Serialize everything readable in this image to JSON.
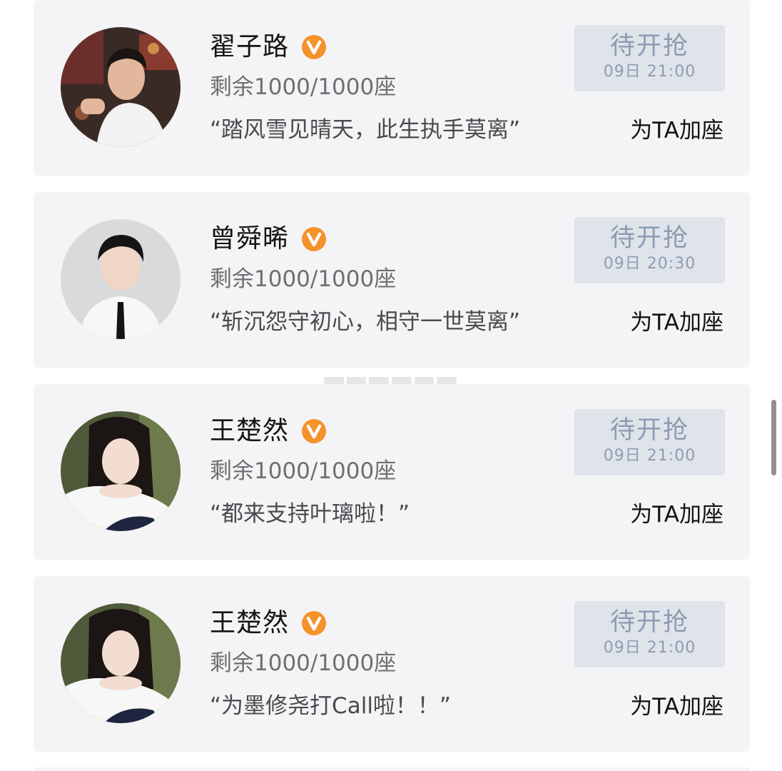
{
  "cards": [
    {
      "name": "翟子路",
      "remaining": "剩余1000/1000座",
      "slogan": "“踏风雪见晴天，此生执手莫离”",
      "button_label": "待开抢",
      "button_time": "09日 21:00",
      "action": "为TA加座"
    },
    {
      "name": "曾舜晞",
      "remaining": "剩余1000/1000座",
      "slogan": "“斩沉怨守初心，相守一世莫离”",
      "button_label": "待开抢",
      "button_time": "09日 20:30",
      "action": "为TA加座"
    },
    {
      "name": "王楚然",
      "remaining": "剩余1000/1000座",
      "slogan": "“都来支持叶璃啦！”",
      "button_label": "待开抢",
      "button_time": "09日 21:00",
      "action": "为TA加座"
    },
    {
      "name": "王楚然",
      "remaining": "剩余1000/1000座",
      "slogan": "“为墨修尧打Call啦！！”",
      "button_label": "待开抢",
      "button_time": "09日 21:00",
      "action": "为TA加座"
    }
  ],
  "icons": {
    "verified": "verified-v-badge-icon"
  },
  "colors": {
    "card_bg": "#f4f4f6",
    "badge_orange": "#f5922a",
    "button_bg": "#dfe3ea",
    "button_text": "#8d9cb2"
  }
}
